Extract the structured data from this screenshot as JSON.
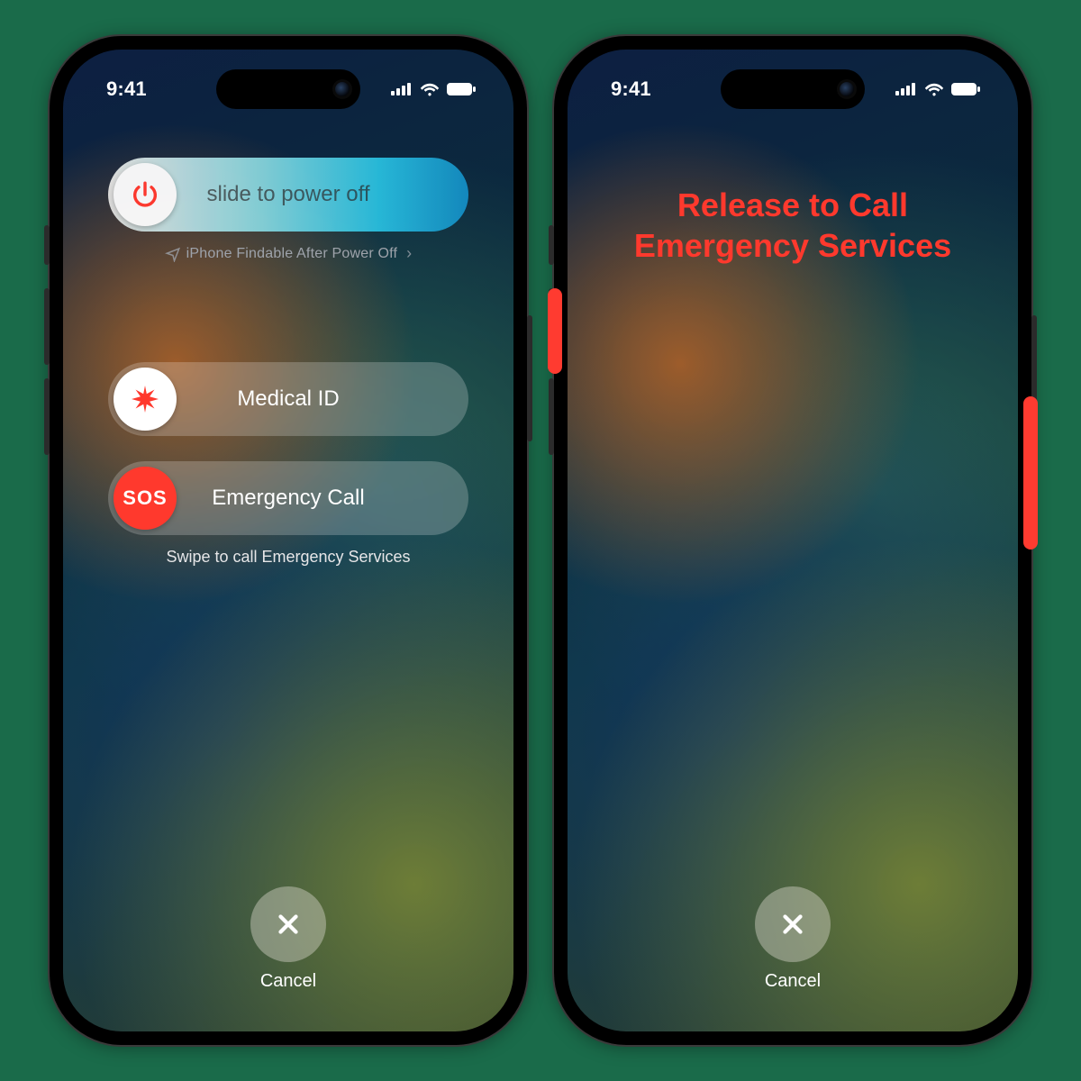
{
  "status": {
    "time": "9:41"
  },
  "left_screen": {
    "power_slider_label": "slide to power off",
    "findable_text": "iPhone Findable After Power Off",
    "medical_id_label": "Medical ID",
    "sos_knob_text": "SOS",
    "emergency_label": "Emergency Call",
    "swipe_hint": "Swipe to call Emergency Services",
    "cancel_label": "Cancel"
  },
  "right_screen": {
    "headline_line1": "Release to Call",
    "headline_line2": "Emergency Services",
    "cancel_label": "Cancel"
  }
}
